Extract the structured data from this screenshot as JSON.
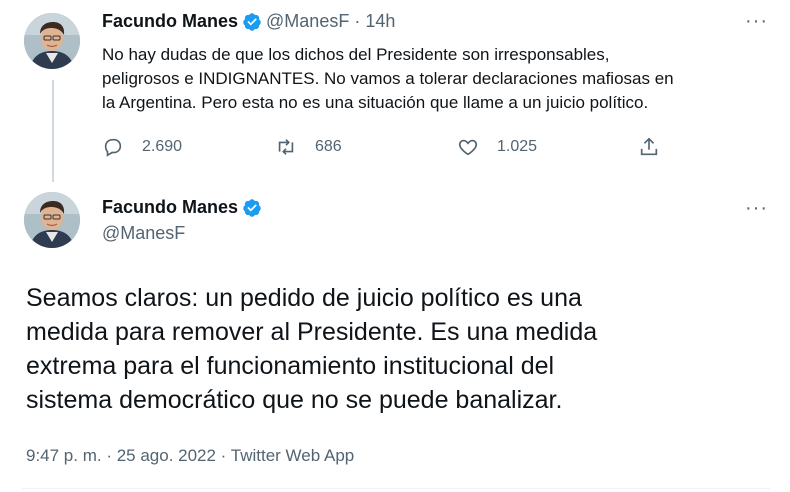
{
  "colors": {
    "text": "#0f1419",
    "secondary": "#536471",
    "verified": "#1d9bf0",
    "thread_line": "#cfd9de"
  },
  "icons": {
    "verified": "verified-badge-icon",
    "more": "more-icon",
    "reply": "reply-icon",
    "retweet": "retweet-icon",
    "like": "like-icon",
    "share": "share-icon"
  },
  "tweet1": {
    "author_name": "Facundo Manes",
    "handle": "@ManesF",
    "separator": "·",
    "time": "14h",
    "more": "···",
    "lines": [
      "No hay dudas de que los dichos del Presidente son irresponsables,",
      "peligrosos e INDIGNANTES. No vamos a tolerar declaraciones mafiosas en",
      "la Argentina. Pero esta no es una situación que llame a un juicio político."
    ],
    "replies": "2.690",
    "retweets": "686",
    "likes": "1.025"
  },
  "tweet2": {
    "author_name": "Facundo Manes",
    "handle": "@ManesF",
    "more": "···",
    "lines": [
      "Seamos claros: un pedido de juicio político es una",
      "medida para remover al Presidente. Es una medida",
      "extrema para el funcionamiento institucional del",
      "sistema democrático que no se puede banalizar."
    ],
    "meta": "9:47 p. m. · 25 ago. 2022 · Twitter Web App"
  }
}
